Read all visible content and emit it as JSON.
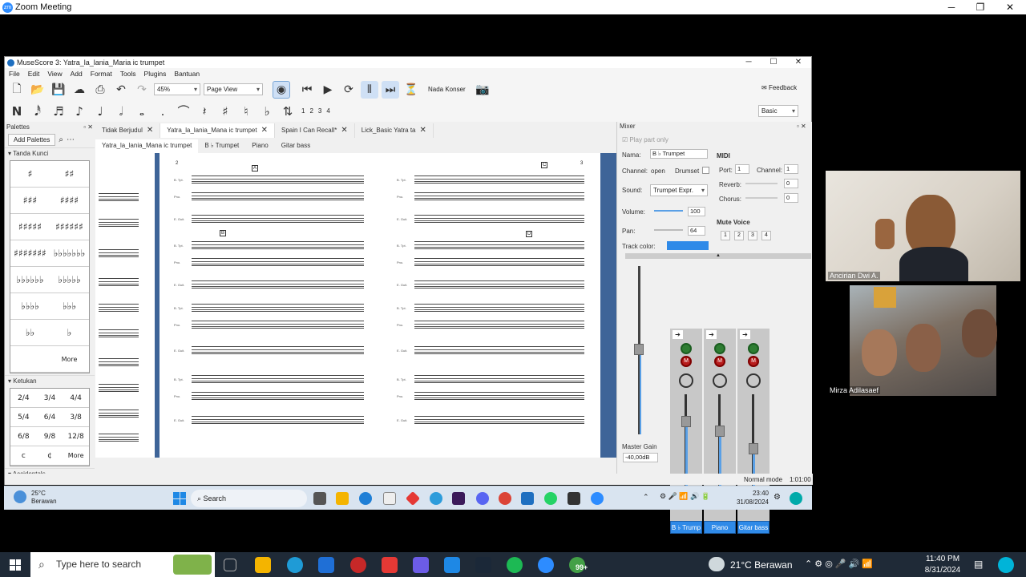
{
  "zoom": {
    "title": "Zoom Meeting",
    "logo": "zm"
  },
  "musescore": {
    "title": "MuseScore 3: Yatra_la_lania_Maria ic trumpet",
    "menu": [
      "File",
      "Edit",
      "View",
      "Add",
      "Format",
      "Tools",
      "Plugins",
      "Bantuan"
    ],
    "zoom_value": "45%",
    "view_mode": "Page View",
    "concert_label": "Nada Konser",
    "feedback_label": "Feedback",
    "workspace": "Basic",
    "voices": [
      "1",
      "2",
      "3",
      "4"
    ],
    "palettes": {
      "title": "Palettes",
      "add_button": "Add Palettes",
      "sections": [
        {
          "name": "Tanda Kunci",
          "more": "More"
        },
        {
          "name": "Ketukan",
          "more": "More"
        },
        {
          "name": "Accidentals"
        }
      ],
      "key_signatures": [
        "♯",
        "♯♯",
        "♯♯♯",
        "♯♯♯♯",
        "♯♯♯♯♯",
        "♯♯♯♯♯♯",
        "♯♯♯♯♯♯♯",
        "♭♭♭♭♭♭♭",
        "♭♭♭♭♭♭",
        "♭♭♭♭♭",
        "♭♭♭♭",
        "♭♭♭",
        "♭♭",
        "♭",
        "",
        ""
      ],
      "time_signatures": [
        "2/4",
        "3/4",
        "4/4",
        "5/4",
        "6/4",
        "3/8",
        "6/8",
        "9/8",
        "12/8",
        "c",
        "¢"
      ]
    },
    "tabs": [
      {
        "label": "Tidak Berjudul"
      },
      {
        "label": "Yatra_la_lania_Mana ic trumpet",
        "active": true
      },
      {
        "label": "Spain I Can Recall*"
      },
      {
        "label": "Lick_Basic Yatra ta"
      }
    ],
    "part_tabs": [
      "Yatra_la_lania_Mana ic trumpet",
      "B ♭ Trumpet",
      "Piano",
      "Gitar bass"
    ],
    "score": {
      "rehearsal": [
        "A",
        "B",
        "C",
        "D"
      ],
      "pages": [
        "2",
        "3"
      ],
      "staff_labels": [
        "B. Tpt.",
        "Pno.",
        "E. Guit."
      ]
    },
    "mixer": {
      "title": "Mixer",
      "play_part_only": "Play part only",
      "name_label": "Nama:",
      "name_value": "B ♭ Trumpet",
      "channel_label": "Channel:",
      "channel_value": "open",
      "drumset_label": "Drumset",
      "sound_label": "Sound:",
      "sound_value": "Trumpet Expr.",
      "volume_label": "Volume:",
      "volume_value": "100",
      "pan_label": "Pan:",
      "pan_value": "64",
      "track_color_label": "Track color:",
      "track_color": "#2f8ae8",
      "midi_label": "MIDI",
      "port_label": "Port:",
      "port_value": "1",
      "channel2_label": "Channel:",
      "channel2_value": "1",
      "reverb_label": "Reverb:",
      "reverb_value": "0",
      "chorus_label": "Chorus:",
      "chorus_value": "0",
      "mute_voice_label": "Mute Voice",
      "voices": [
        "1",
        "2",
        "3",
        "4"
      ],
      "master_gain_label": "Master Gain",
      "master_gain_value": "-40,00dB",
      "channels": [
        {
          "name": "B ♭ Trump",
          "volume": 0.75
        },
        {
          "name": "Piano",
          "volume": 0.66
        },
        {
          "name": "Gitar bass",
          "volume": 0.5
        }
      ]
    },
    "status": {
      "mode": "Normal mode",
      "time": "1:01:00"
    }
  },
  "inner_taskbar": {
    "weather_temp": "25°C",
    "weather_desc": "Berawan",
    "search": "Search",
    "time": "23:40",
    "date": "31/08/2024"
  },
  "participants": [
    {
      "name": "Ancirian Dwi A."
    },
    {
      "name": "Mirza Adilasaef"
    }
  ],
  "outer_taskbar": {
    "search_placeholder": "Type here to search",
    "weather": "21°C Berawan",
    "time": "11:40 PM",
    "date": "8/31/2024",
    "badge": "99+"
  }
}
